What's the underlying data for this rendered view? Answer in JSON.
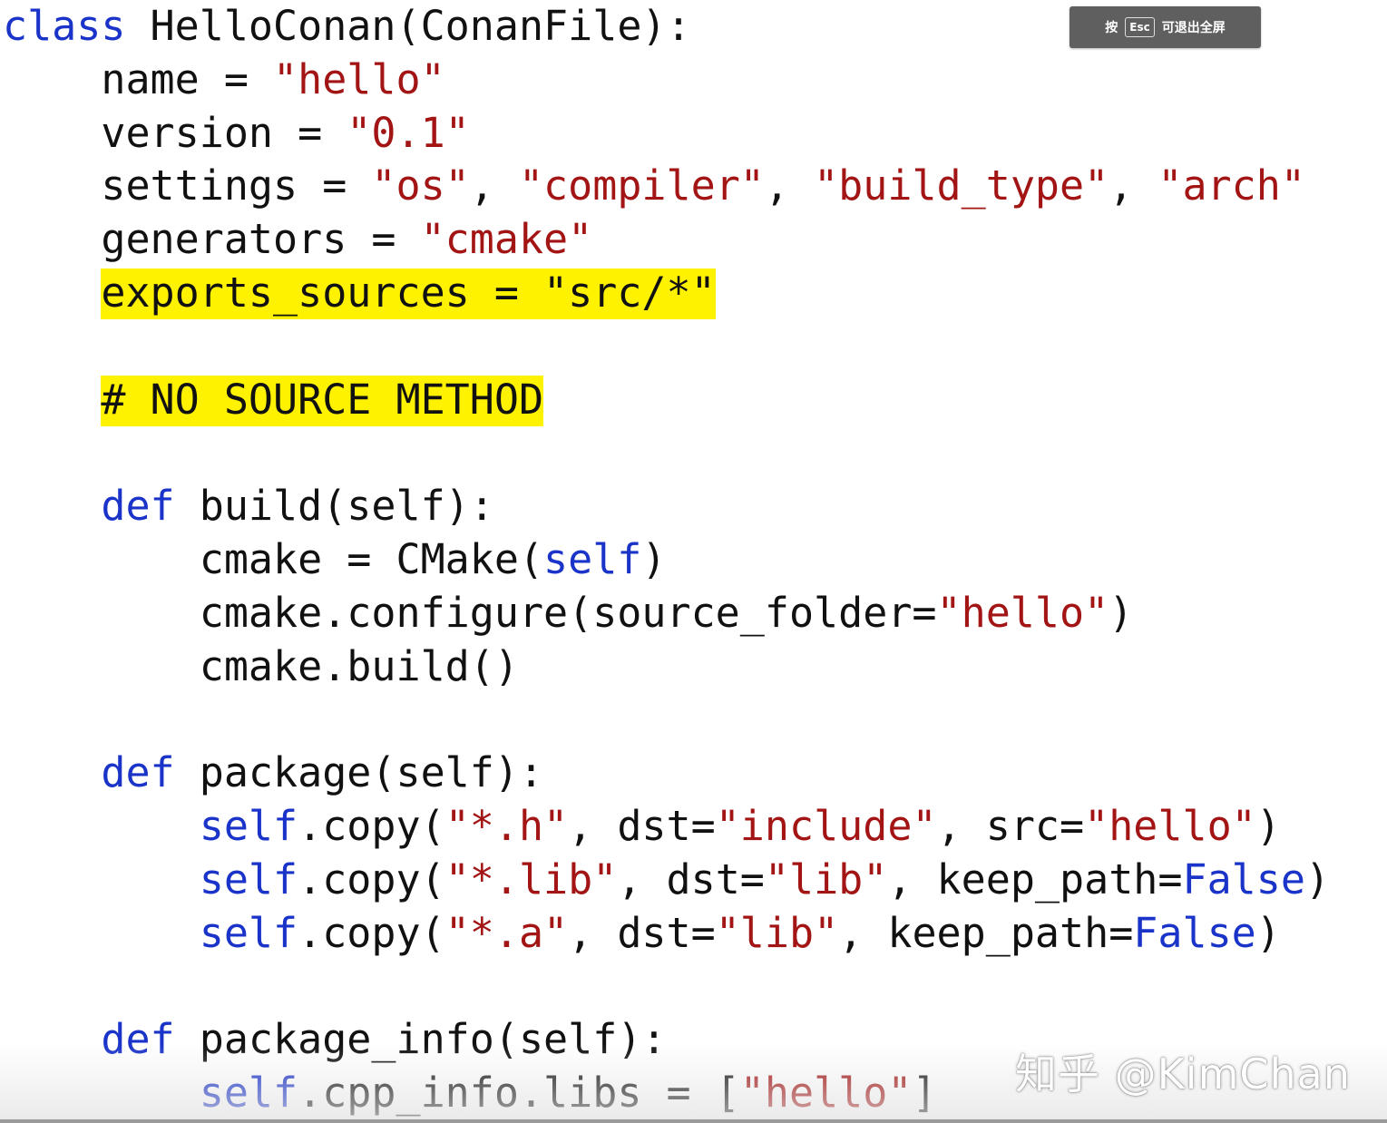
{
  "esc_hint": {
    "prefix": "按",
    "key": "Esc",
    "suffix": "可退出全屏"
  },
  "watermark": "知乎 @KimChan",
  "colors": {
    "keyword": "#1a33c9",
    "string": "#a31515",
    "default": "#111111",
    "highlight": "#fff200"
  },
  "code": [
    [
      {
        "t": "kw",
        "v": "class"
      },
      {
        "t": "id",
        "v": " HelloConan(ConanFile):"
      }
    ],
    [
      {
        "t": "id",
        "v": "    name = "
      },
      {
        "t": "str",
        "v": "\"hello\""
      }
    ],
    [
      {
        "t": "id",
        "v": "    version = "
      },
      {
        "t": "str",
        "v": "\"0.1\""
      }
    ],
    [
      {
        "t": "id",
        "v": "    settings = "
      },
      {
        "t": "str",
        "v": "\"os\""
      },
      {
        "t": "id",
        "v": ", "
      },
      {
        "t": "str",
        "v": "\"compiler\""
      },
      {
        "t": "id",
        "v": ", "
      },
      {
        "t": "str",
        "v": "\"build_type\""
      },
      {
        "t": "id",
        "v": ", "
      },
      {
        "t": "str",
        "v": "\"arch\""
      }
    ],
    [
      {
        "t": "id",
        "v": "    generators = "
      },
      {
        "t": "str",
        "v": "\"cmake\""
      }
    ],
    [
      {
        "t": "id",
        "v": "    "
      },
      {
        "t": "hl",
        "v": "exports_sources = \"src/*\""
      }
    ],
    [],
    [
      {
        "t": "id",
        "v": "    "
      },
      {
        "t": "hl",
        "v": "# NO SOURCE METHOD"
      }
    ],
    [],
    [
      {
        "t": "id",
        "v": "    "
      },
      {
        "t": "kw",
        "v": "def"
      },
      {
        "t": "id",
        "v": " build(self):"
      }
    ],
    [
      {
        "t": "id",
        "v": "        cmake = CMake("
      },
      {
        "t": "kw",
        "v": "self"
      },
      {
        "t": "id",
        "v": ")"
      }
    ],
    [
      {
        "t": "id",
        "v": "        cmake.configure(source_folder="
      },
      {
        "t": "str",
        "v": "\"hello\""
      },
      {
        "t": "id",
        "v": ")"
      }
    ],
    [
      {
        "t": "id",
        "v": "        cmake.build()"
      }
    ],
    [],
    [
      {
        "t": "id",
        "v": "    "
      },
      {
        "t": "kw",
        "v": "def"
      },
      {
        "t": "id",
        "v": " package(self):"
      }
    ],
    [
      {
        "t": "id",
        "v": "        "
      },
      {
        "t": "kw",
        "v": "self"
      },
      {
        "t": "id",
        "v": ".copy("
      },
      {
        "t": "str",
        "v": "\"*.h\""
      },
      {
        "t": "id",
        "v": ", dst="
      },
      {
        "t": "str",
        "v": "\"include\""
      },
      {
        "t": "id",
        "v": ", src="
      },
      {
        "t": "str",
        "v": "\"hello\""
      },
      {
        "t": "id",
        "v": ")"
      }
    ],
    [
      {
        "t": "id",
        "v": "        "
      },
      {
        "t": "kw",
        "v": "self"
      },
      {
        "t": "id",
        "v": ".copy("
      },
      {
        "t": "str",
        "v": "\"*.lib\""
      },
      {
        "t": "id",
        "v": ", dst="
      },
      {
        "t": "str",
        "v": "\"lib\""
      },
      {
        "t": "id",
        "v": ", keep_path="
      },
      {
        "t": "kw",
        "v": "False"
      },
      {
        "t": "id",
        "v": ")"
      }
    ],
    [
      {
        "t": "id",
        "v": "        "
      },
      {
        "t": "kw",
        "v": "self"
      },
      {
        "t": "id",
        "v": ".copy("
      },
      {
        "t": "str",
        "v": "\"*.a\""
      },
      {
        "t": "id",
        "v": ", dst="
      },
      {
        "t": "str",
        "v": "\"lib\""
      },
      {
        "t": "id",
        "v": ", keep_path="
      },
      {
        "t": "kw",
        "v": "False"
      },
      {
        "t": "id",
        "v": ")"
      }
    ],
    [],
    [
      {
        "t": "id",
        "v": "    "
      },
      {
        "t": "kw",
        "v": "def"
      },
      {
        "t": "id",
        "v": " package_info(self):"
      }
    ],
    [
      {
        "t": "id",
        "v": "        "
      },
      {
        "t": "kw",
        "v": "self"
      },
      {
        "t": "id",
        "v": ".cpp_info.libs = ["
      },
      {
        "t": "str",
        "v": "\"hello\""
      },
      {
        "t": "id",
        "v": "]"
      }
    ]
  ]
}
